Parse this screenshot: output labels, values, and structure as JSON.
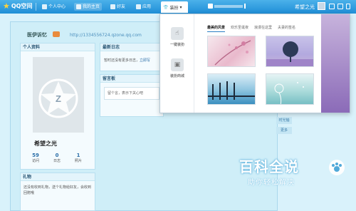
{
  "topbar": {
    "logo": "QQ空间",
    "nav": [
      "个人中心",
      "我的主页",
      "好友",
      "应用"
    ],
    "dress": "装扮",
    "user_name": "希望之光"
  },
  "page": {
    "site_title": "医伊诉忆",
    "url": "http://1334556724.qzone.qq.com"
  },
  "profile": {
    "section_title": "个人资料",
    "name": "希望之光",
    "stats": [
      {
        "value": "59",
        "label": "访问"
      },
      {
        "value": "0",
        "label": "日志"
      },
      {
        "value": "1",
        "label": "照片"
      }
    ]
  },
  "blog": {
    "title": "最新日志",
    "empty_text": "暂时还没有更多日志，",
    "link": "立即写"
  },
  "board": {
    "title": "留言板",
    "placeholder": "留个言，表示下关心吧"
  },
  "gift": {
    "title": "礼物",
    "text": "还没有收到礼物，送个礼物给好友，会收到回赠哦"
  },
  "right_buttons": [
    "时光轴",
    "更多"
  ],
  "dropdown": {
    "options": [
      {
        "label": "一键装扮",
        "icon": "hand-icon"
      },
      {
        "label": "装扮商城",
        "icon": "bag-icon"
      }
    ],
    "tabs": [
      "最美的风景",
      "欢乐圣诞夜",
      "浪漫在这里",
      "夫妻的签名"
    ],
    "active_tab": 0
  },
  "watermark": {
    "big": "百科全说",
    "small": "助你轻松解决"
  }
}
